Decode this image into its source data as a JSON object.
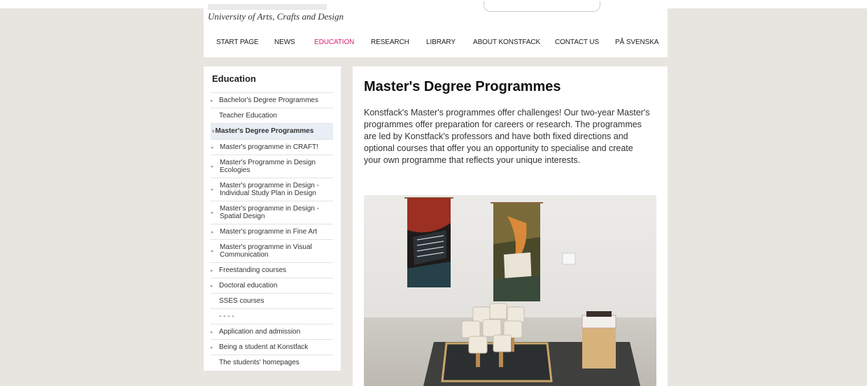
{
  "header": {
    "tagline": "University of Arts, Crafts and Design"
  },
  "nav": {
    "items": [
      {
        "label": "START PAGE"
      },
      {
        "label": "NEWS"
      },
      {
        "label": "EDUCATION"
      },
      {
        "label": "RESEARCH"
      },
      {
        "label": "LIBRARY"
      },
      {
        "label": "ABOUT KONSTFACK"
      },
      {
        "label": "CONTACT US"
      },
      {
        "label": "PÅ SVENSKA"
      }
    ],
    "active_color": "#d6247a"
  },
  "sidebar": {
    "title": "Education",
    "items": [
      {
        "label": "Bachelor's Degree Programmes",
        "arrow": "▸"
      },
      {
        "label": "Teacher Education"
      },
      {
        "label": "Master's Degree Programmes",
        "arrow": "▾"
      },
      {
        "label": "Master's programme in CRAFT!",
        "arrow": "▸"
      },
      {
        "label": "Master's Programme in Design Ecologies",
        "arrow": "▸"
      },
      {
        "label": "Master's programme in Design - Individual Study Plan in Design",
        "arrow": "▸"
      },
      {
        "label": "Master's programme in Design - Spatial Design",
        "arrow": "▸"
      },
      {
        "label": "Master's programme in Fine Art",
        "arrow": "▸"
      },
      {
        "label": "Master's programme in Visual Communication",
        "arrow": "▸"
      },
      {
        "label": "Freestanding courses",
        "arrow": "▸"
      },
      {
        "label": "Doctoral education",
        "arrow": "▸"
      },
      {
        "label": "SSES courses"
      },
      {
        "label": "- - - -"
      },
      {
        "label": "Application and admission",
        "arrow": "▸"
      },
      {
        "label": "Being a student at Konstfack",
        "arrow": "▸"
      },
      {
        "label": "The students' homepages"
      }
    ]
  },
  "main": {
    "title": "Master's Degree Programmes",
    "intro": "Konstfack's Master's programmes offer challenges! Our two-year Master's programmes offer preparation for careers or research. The programmes are led by Konstfack's professors and have both fixed directions and optional courses that offer you an opportunity to specialise and create your own programme that reflects your unique interests."
  },
  "colors": {
    "background": "#e8e4e0",
    "selected_bg": "#e8eef5"
  }
}
